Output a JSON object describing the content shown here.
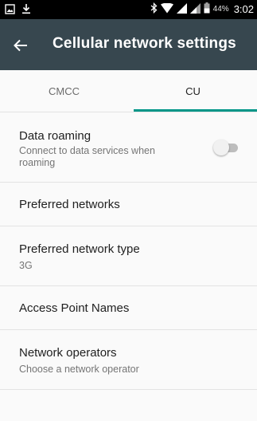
{
  "status_bar": {
    "battery_percent": "44%",
    "time": "3:02",
    "icons": [
      "gallery-icon",
      "download-icon",
      "bluetooth-icon",
      "wifi-icon",
      "signal-icon",
      "signal-icon",
      "battery-icon"
    ]
  },
  "app_bar": {
    "title": "Cellular network settings",
    "back_icon": "arrow-back-icon",
    "background": "#37474f"
  },
  "tabs": [
    {
      "label": "CMCC",
      "selected": false
    },
    {
      "label": "CU",
      "selected": true
    }
  ],
  "accent_color": "#009688",
  "settings": {
    "data_roaming": {
      "title": "Data roaming",
      "summary": "Connect to data services when roaming",
      "enabled": false
    },
    "preferred_networks": {
      "title": "Preferred networks"
    },
    "preferred_network_type": {
      "title": "Preferred network type",
      "summary": "3G"
    },
    "access_point_names": {
      "title": "Access Point Names"
    },
    "network_operators": {
      "title": "Network operators",
      "summary": "Choose a network operator"
    }
  }
}
